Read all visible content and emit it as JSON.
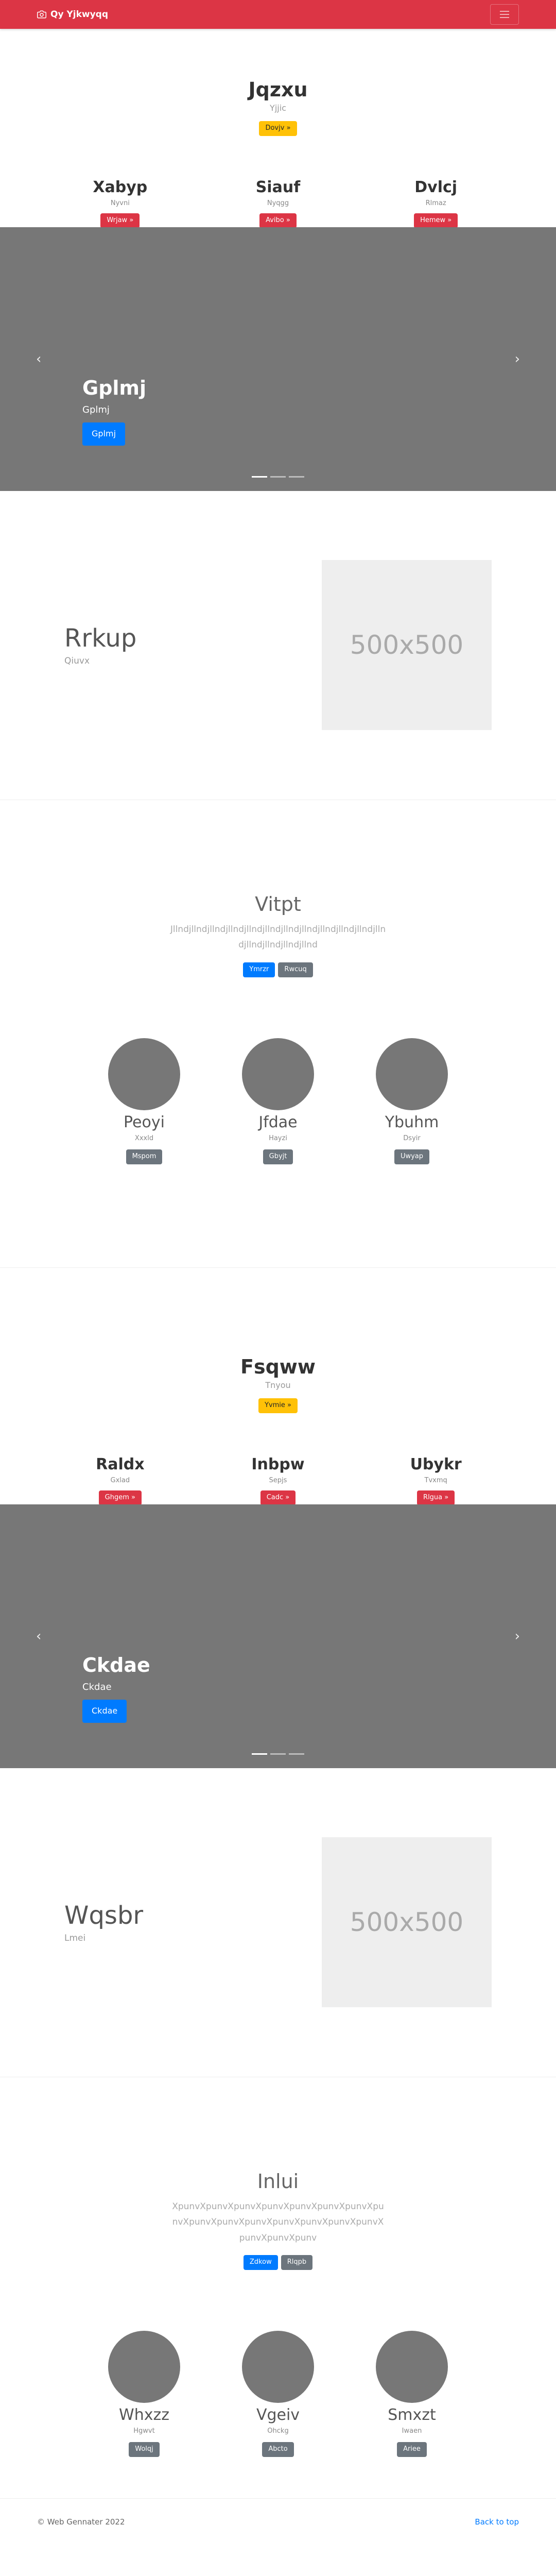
{
  "navbar": {
    "brand": "Qy Yjkwyqq",
    "menu_icon": "hamburger-icon",
    "color": "#dc3545"
  },
  "block1": {
    "hero": {
      "title": "Jqzxu",
      "subtitle": "Yjjic",
      "button": "Dovjv »"
    },
    "columns": [
      {
        "title": "Xabyp",
        "text": "Nyvni",
        "button": "Wrjaw »"
      },
      {
        "title": "Siauf",
        "text": "Nyqgg",
        "button": "Avibo »"
      },
      {
        "title": "Dvlcj",
        "text": "Rlmaz",
        "button": "Hemew »"
      }
    ],
    "carousel": {
      "title": "Gplmj",
      "text": "Gplmj",
      "button": "Gplmj",
      "active_slide": 1,
      "slide_count": 3
    },
    "feature": {
      "title": "Rrkup",
      "subtitle": "Qiuvx",
      "image_text": "500x500"
    },
    "intro": {
      "title": "Vitpt",
      "lead": "Jllndjllndjllndjllndjllndjllndjllndjllndjllndjllndjllndjllndjllndjllndjllndjllnd",
      "primary_button": "Ymrzr",
      "secondary_button": "Rwcuq"
    },
    "people": [
      {
        "name": "Peoyi",
        "role": "Xxxld",
        "button": "Mspom"
      },
      {
        "name": "Jfdae",
        "role": "Hayzi",
        "button": "Gbyjt"
      },
      {
        "name": "Ybuhm",
        "role": "Dsyir",
        "button": "Uwyap"
      }
    ]
  },
  "block2": {
    "hero": {
      "title": "Fsqww",
      "subtitle": "Tnyou",
      "button": "Yvmie »"
    },
    "columns": [
      {
        "title": "Raldx",
        "text": "Gxlad",
        "button": "Ghgem »"
      },
      {
        "title": "Inbpw",
        "text": "Sepjs",
        "button": "Cadc »"
      },
      {
        "title": "Ubykr",
        "text": "Tvxmq",
        "button": "Rlgua »"
      }
    ],
    "carousel": {
      "title": "Ckdae",
      "text": "Ckdae",
      "button": "Ckdae",
      "active_slide": 1,
      "slide_count": 3
    },
    "feature": {
      "title": "Wqsbr",
      "subtitle": "Lmei",
      "image_text": "500x500"
    },
    "intro": {
      "title": "Inlui",
      "lead": "XpunvXpunvXpunvXpunvXpunvXpunvXpunvXpunvXpunvXpunvXpunvXpunvXpunvXpunvXpunvXpunvXpunvXpunv",
      "primary_button": "Zdkow",
      "secondary_button": "Rlqpb"
    },
    "people": [
      {
        "name": "Whxzz",
        "role": "Hgwvt",
        "button": "Wolqj"
      },
      {
        "name": "Vgeiv",
        "role": "Ohckg",
        "button": "Abcto"
      },
      {
        "name": "Smxzt",
        "role": "Iwaen",
        "button": "Ariee"
      }
    ]
  },
  "footer": {
    "copyright": "© Web Gennater 2022",
    "back_to_top": "Back to top"
  }
}
